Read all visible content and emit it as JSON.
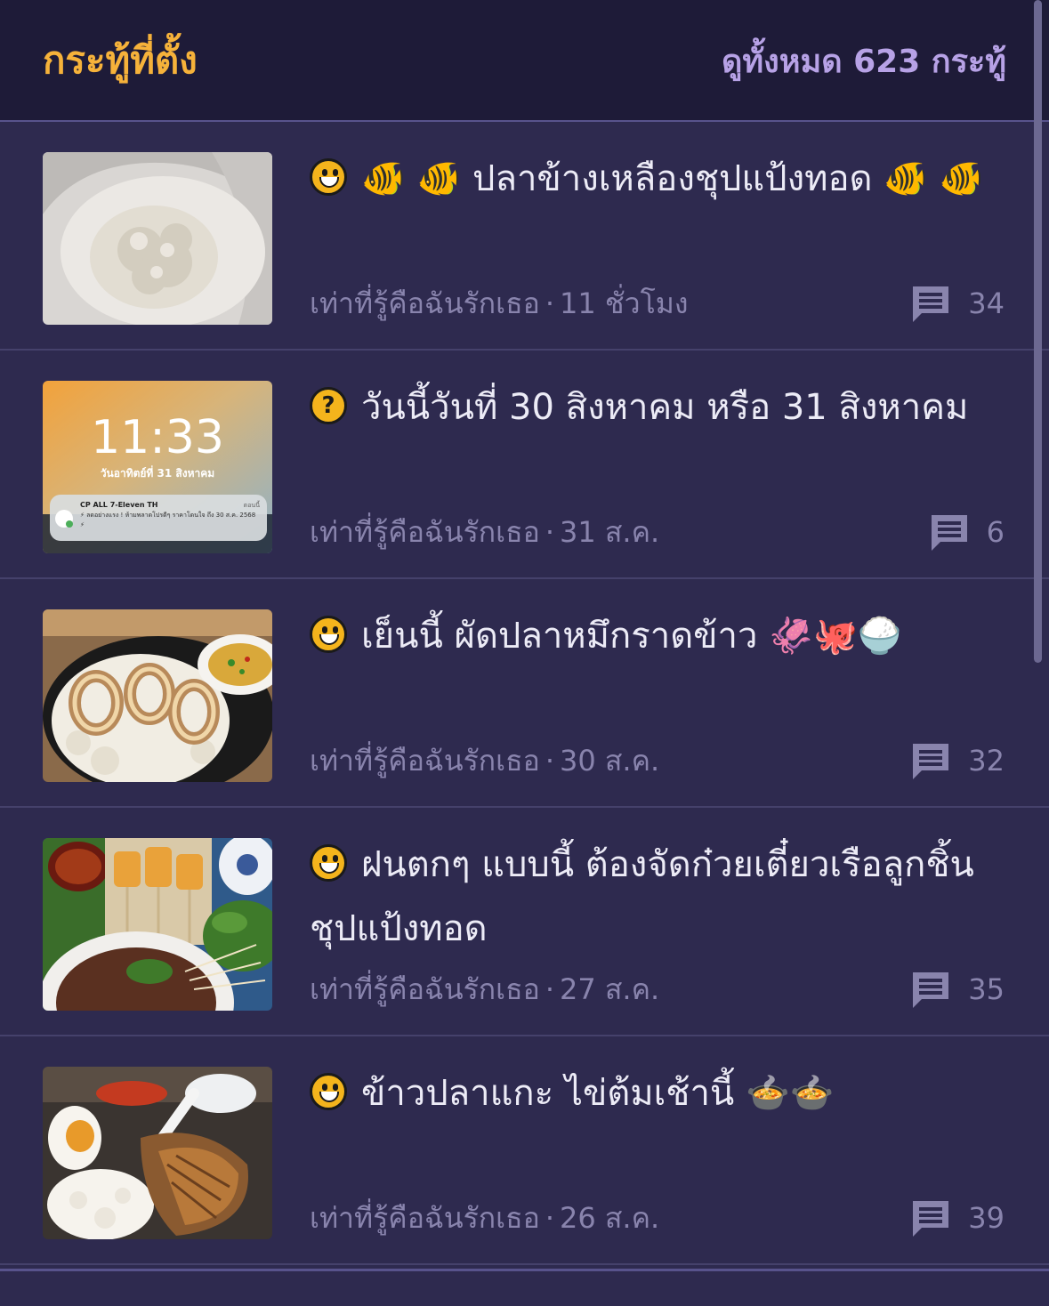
{
  "header": {
    "title": "กระทู้ที่ตั้ง",
    "view_all": "ดูทั้งหมด 623 กระทู้"
  },
  "topics": [
    {
      "tag_icon": "laughing-face-icon",
      "title": "ปลาข้างเหลืองชุปแป้งทอด",
      "emojis_before": "🐠 🐠",
      "emojis_after": "🐠 🐠",
      "author": "เท่าที่รู้คือฉันรักเธอ",
      "time": "11 ชั่วโมง",
      "comments": "34",
      "thumbnail": "flour-in-bowl"
    },
    {
      "tag_icon": "question-bubble-icon",
      "title": "วันนี้วันที่ 30 สิงหาคม หรือ 31 สิงหาคม",
      "emojis_before": "",
      "emojis_after": "",
      "author": "เท่าที่รู้คือฉันรักเธอ",
      "time": "31 ส.ค.",
      "comments": "6",
      "thumbnail": "lockscreen",
      "lockscreen": {
        "clock": "11:33",
        "date": "วันอาทิตย์ที่ 31 สิงหาคม",
        "notif_app": "CP ALL 7-Eleven TH",
        "notif_time": "ตอนนี้",
        "notif_text": "⚡ ลดอย่างแรง ! ห้ามพลาดโปรดีๆ ราคาโดนใจ ถึง 30 ส.ค. 2568 ⚡"
      }
    },
    {
      "tag_icon": "laughing-face-icon",
      "title": "เย็นนี้ ผัดปลาหมึกราดข้าว",
      "emojis_before": "",
      "emojis_after": "🦑🐙🍚",
      "author": "เท่าที่รู้คือฉันรักเธอ",
      "time": "30 ส.ค.",
      "comments": "32",
      "thumbnail": "squid-rice"
    },
    {
      "tag_icon": "laughing-face-icon",
      "title": "ฝนตกๆ แบบนี้ ต้องจัดก๋วยเตี๋ยวเรือลูกชิ้นชุปแป้งทอด",
      "emojis_before": "",
      "emojis_after": "",
      "author": "เท่าที่รู้คือฉันรักเธอ",
      "time": "27 ส.ค.",
      "comments": "35",
      "thumbnail": "boat-noodles"
    },
    {
      "tag_icon": "laughing-face-icon",
      "title": "ข้าวปลาแกะ ไข่ต้มเช้านี้",
      "emojis_before": "",
      "emojis_after": "🍲🍲",
      "author": "เท่าที่รู้คือฉันรักเธอ",
      "time": "26 ส.ค.",
      "comments": "39",
      "thumbnail": "fish-rice-egg"
    }
  ],
  "colors": {
    "background": "#2e2a4f",
    "header_bg": "#1e1b38",
    "header_title": "#f6b23a",
    "view_all": "#b7a2e6",
    "meta": "#8984ad"
  }
}
